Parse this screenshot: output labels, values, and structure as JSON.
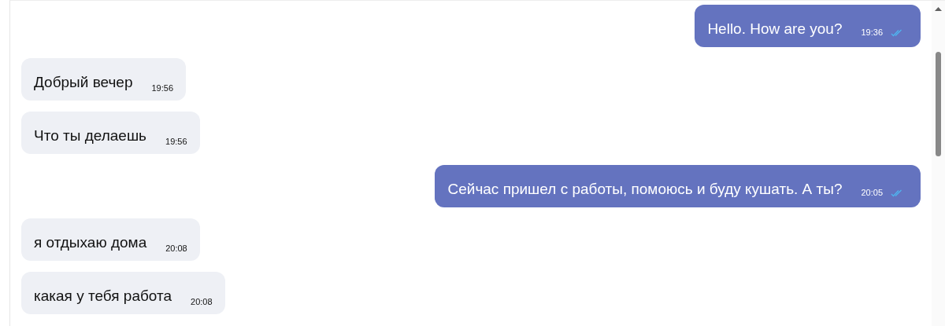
{
  "messages": [
    {
      "kind": "out",
      "text": "Hello. How are you?",
      "time": "19:36",
      "read": true
    },
    {
      "kind": "in",
      "text": "Добрый вечер",
      "time": "19:56"
    },
    {
      "kind": "in",
      "text": "Что ты делаешь",
      "time": "19:56"
    },
    {
      "kind": "out",
      "text": "Сейчас пришел с работы, помоюсь и буду кушать. А ты?",
      "time": "20:05",
      "read": true
    },
    {
      "kind": "in",
      "text": "я отдыхаю дома",
      "time": "20:08"
    },
    {
      "kind": "in",
      "text": "какая у тебя работа",
      "time": "20:08"
    }
  ]
}
